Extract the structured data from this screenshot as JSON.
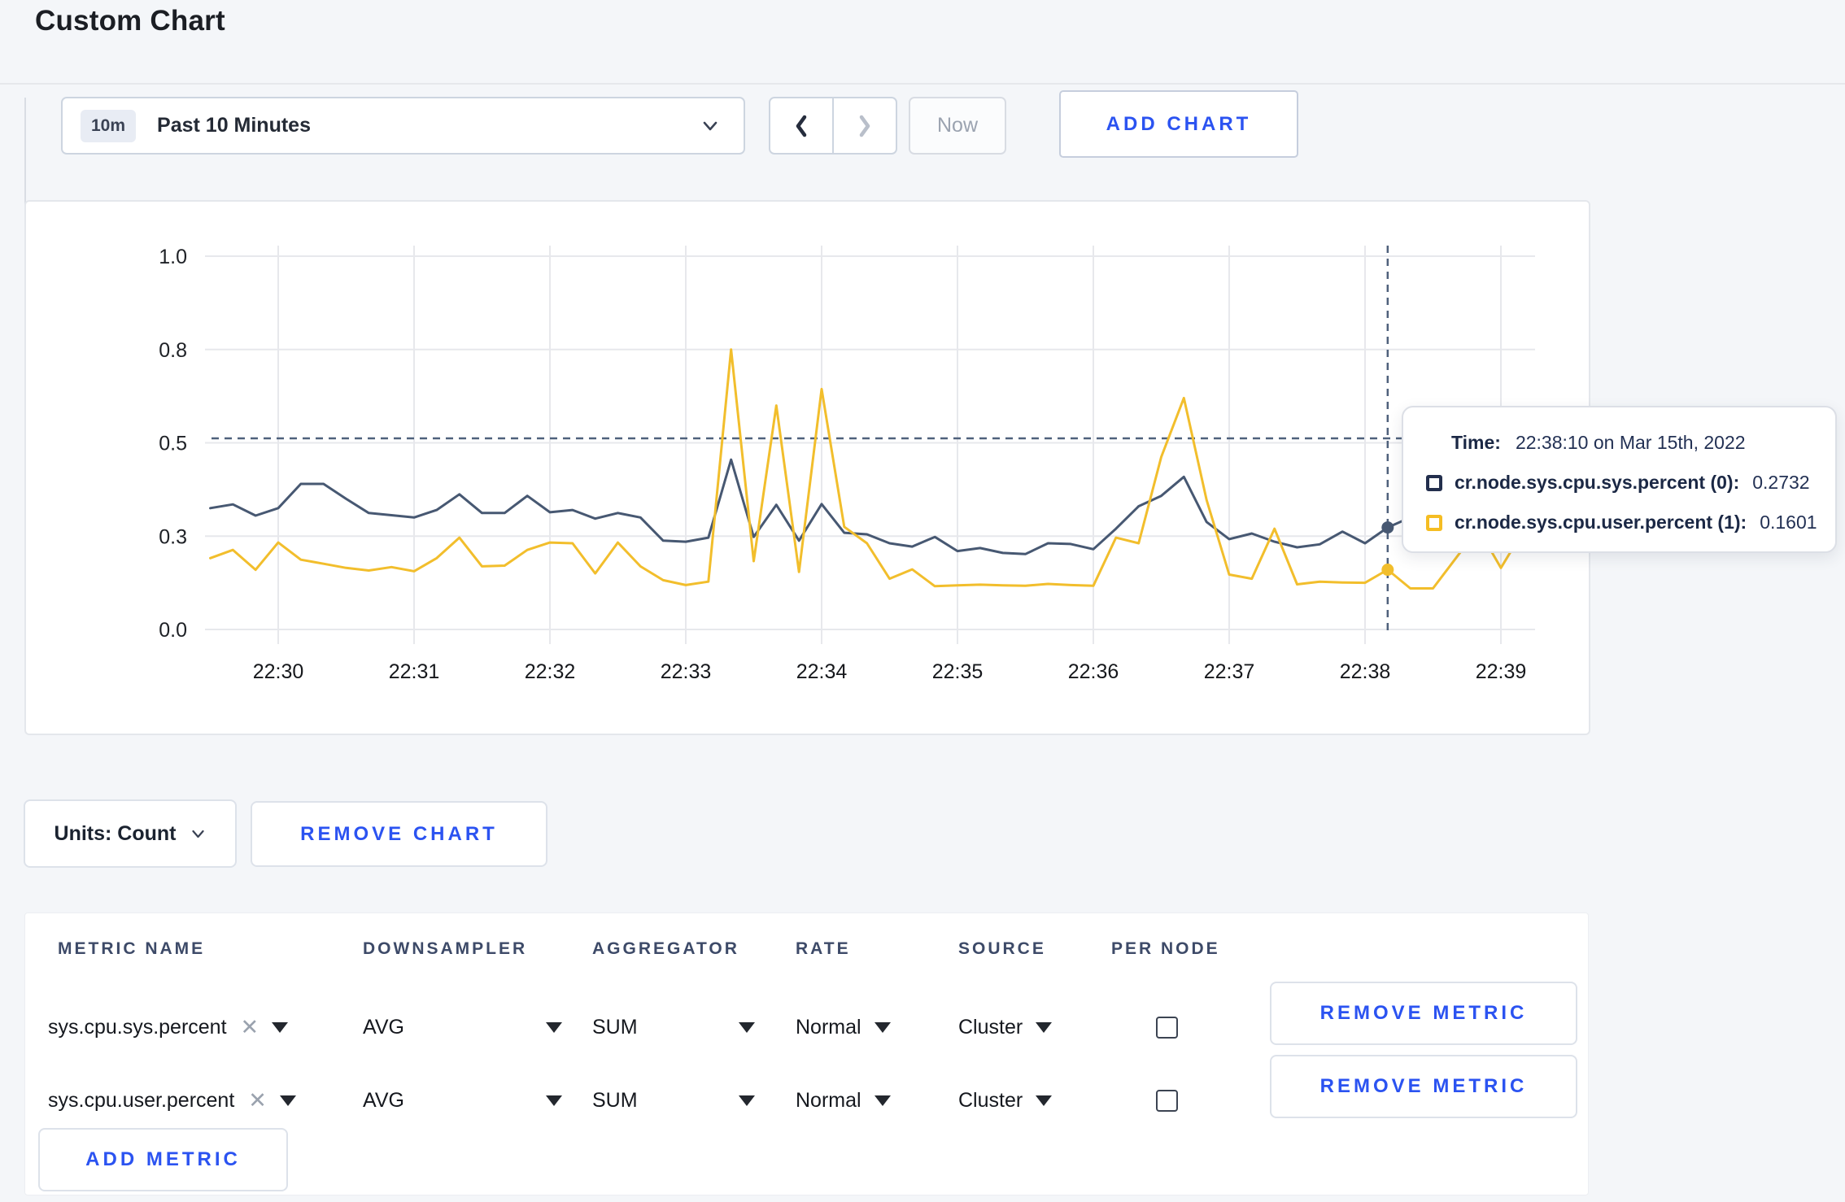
{
  "page": {
    "title": "Custom Chart"
  },
  "toolbar": {
    "range_badge": "10m",
    "range_label": "Past 10 Minutes",
    "now_label": "Now",
    "add_chart_label": "ADD CHART"
  },
  "chart_data": {
    "type": "line",
    "title": "",
    "xlabel": "",
    "ylabel": "",
    "ylim": [
      0,
      1
    ],
    "grid": true,
    "x_ticks": [
      "22:30",
      "22:31",
      "22:32",
      "22:33",
      "22:34",
      "22:35",
      "22:36",
      "22:37",
      "22:38",
      "22:39"
    ],
    "y_tick_values": [
      0,
      0.25,
      0.5,
      0.75,
      1
    ],
    "y_tick_labels": [
      "0.0",
      "0.3",
      "0.5",
      "0.8",
      "1.0"
    ],
    "x_start_offset_seconds": -30,
    "x_step_seconds": 10,
    "series": [
      {
        "name": "cr.node.sys.cpu.sys.percent",
        "color": "#475872",
        "values": [
          0.325,
          0.335,
          0.305,
          0.325,
          0.39,
          0.39,
          0.35,
          0.312,
          0.306,
          0.3,
          0.32,
          0.362,
          0.312,
          0.312,
          0.358,
          0.314,
          0.32,
          0.297,
          0.312,
          0.3,
          0.238,
          0.235,
          0.246,
          0.455,
          0.248,
          0.334,
          0.238,
          0.336,
          0.259,
          0.255,
          0.231,
          0.222,
          0.248,
          0.21,
          0.218,
          0.205,
          0.202,
          0.231,
          0.229,
          0.215,
          0.27,
          0.33,
          0.358,
          0.409,
          0.288,
          0.242,
          0.257,
          0.235,
          0.22,
          0.228,
          0.262,
          0.231,
          0.2732,
          0.3,
          0.29,
          0.295,
          0.31,
          0.3,
          0.305
        ]
      },
      {
        "name": "cr.node.sys.cpu.user.percent",
        "color": "#f2be2c",
        "values": [
          0.191,
          0.213,
          0.16,
          0.233,
          0.187,
          0.176,
          0.165,
          0.158,
          0.167,
          0.156,
          0.191,
          0.246,
          0.169,
          0.171,
          0.213,
          0.233,
          0.231,
          0.15,
          0.233,
          0.169,
          0.132,
          0.119,
          0.128,
          0.75,
          0.183,
          0.6,
          0.154,
          0.644,
          0.275,
          0.231,
          0.136,
          0.161,
          0.116,
          0.118,
          0.12,
          0.118,
          0.117,
          0.122,
          0.119,
          0.117,
          0.246,
          0.231,
          0.462,
          0.62,
          0.347,
          0.147,
          0.136,
          0.27,
          0.121,
          0.128,
          0.126,
          0.125,
          0.1601,
          0.11,
          0.11,
          0.19,
          0.27,
          0.165,
          0.265
        ]
      }
    ],
    "crosshair": {
      "time": "22:38:10",
      "x_seconds_from_2230": 490,
      "point_index": 52,
      "hline_value": 0.512
    },
    "legend_position": "tooltip"
  },
  "tooltip": {
    "time_label": "Time:",
    "time_value": "22:38:10 on Mar 15th, 2022",
    "rows": [
      {
        "label": "cr.node.sys.cpu.sys.percent (0):",
        "value": "0.2732",
        "color": "#232f4d"
      },
      {
        "label": "cr.node.sys.cpu.user.percent (1):",
        "value": "0.1601",
        "color": "#f5bd23"
      }
    ]
  },
  "units_bar": {
    "units_label": "Units: Count",
    "remove_chart_label": "REMOVE CHART"
  },
  "table": {
    "headers": [
      "METRIC NAME",
      "DOWNSAMPLER",
      "AGGREGATOR",
      "RATE",
      "SOURCE",
      "PER NODE"
    ],
    "rows": [
      {
        "metric": "sys.cpu.sys.percent",
        "downsampler": "AVG",
        "aggregator": "SUM",
        "rate": "Normal",
        "source": "Cluster",
        "per_node_checked": false,
        "remove_label": "REMOVE METRIC"
      },
      {
        "metric": "sys.cpu.user.percent",
        "downsampler": "AVG",
        "aggregator": "SUM",
        "rate": "Normal",
        "source": "Cluster",
        "per_node_checked": false,
        "remove_label": "REMOVE METRIC"
      }
    ],
    "add_metric_label": "ADD METRIC"
  },
  "colors": {
    "accent_blue": "#2b53f1",
    "series_sys": "#475872",
    "series_user": "#f2be2c"
  }
}
